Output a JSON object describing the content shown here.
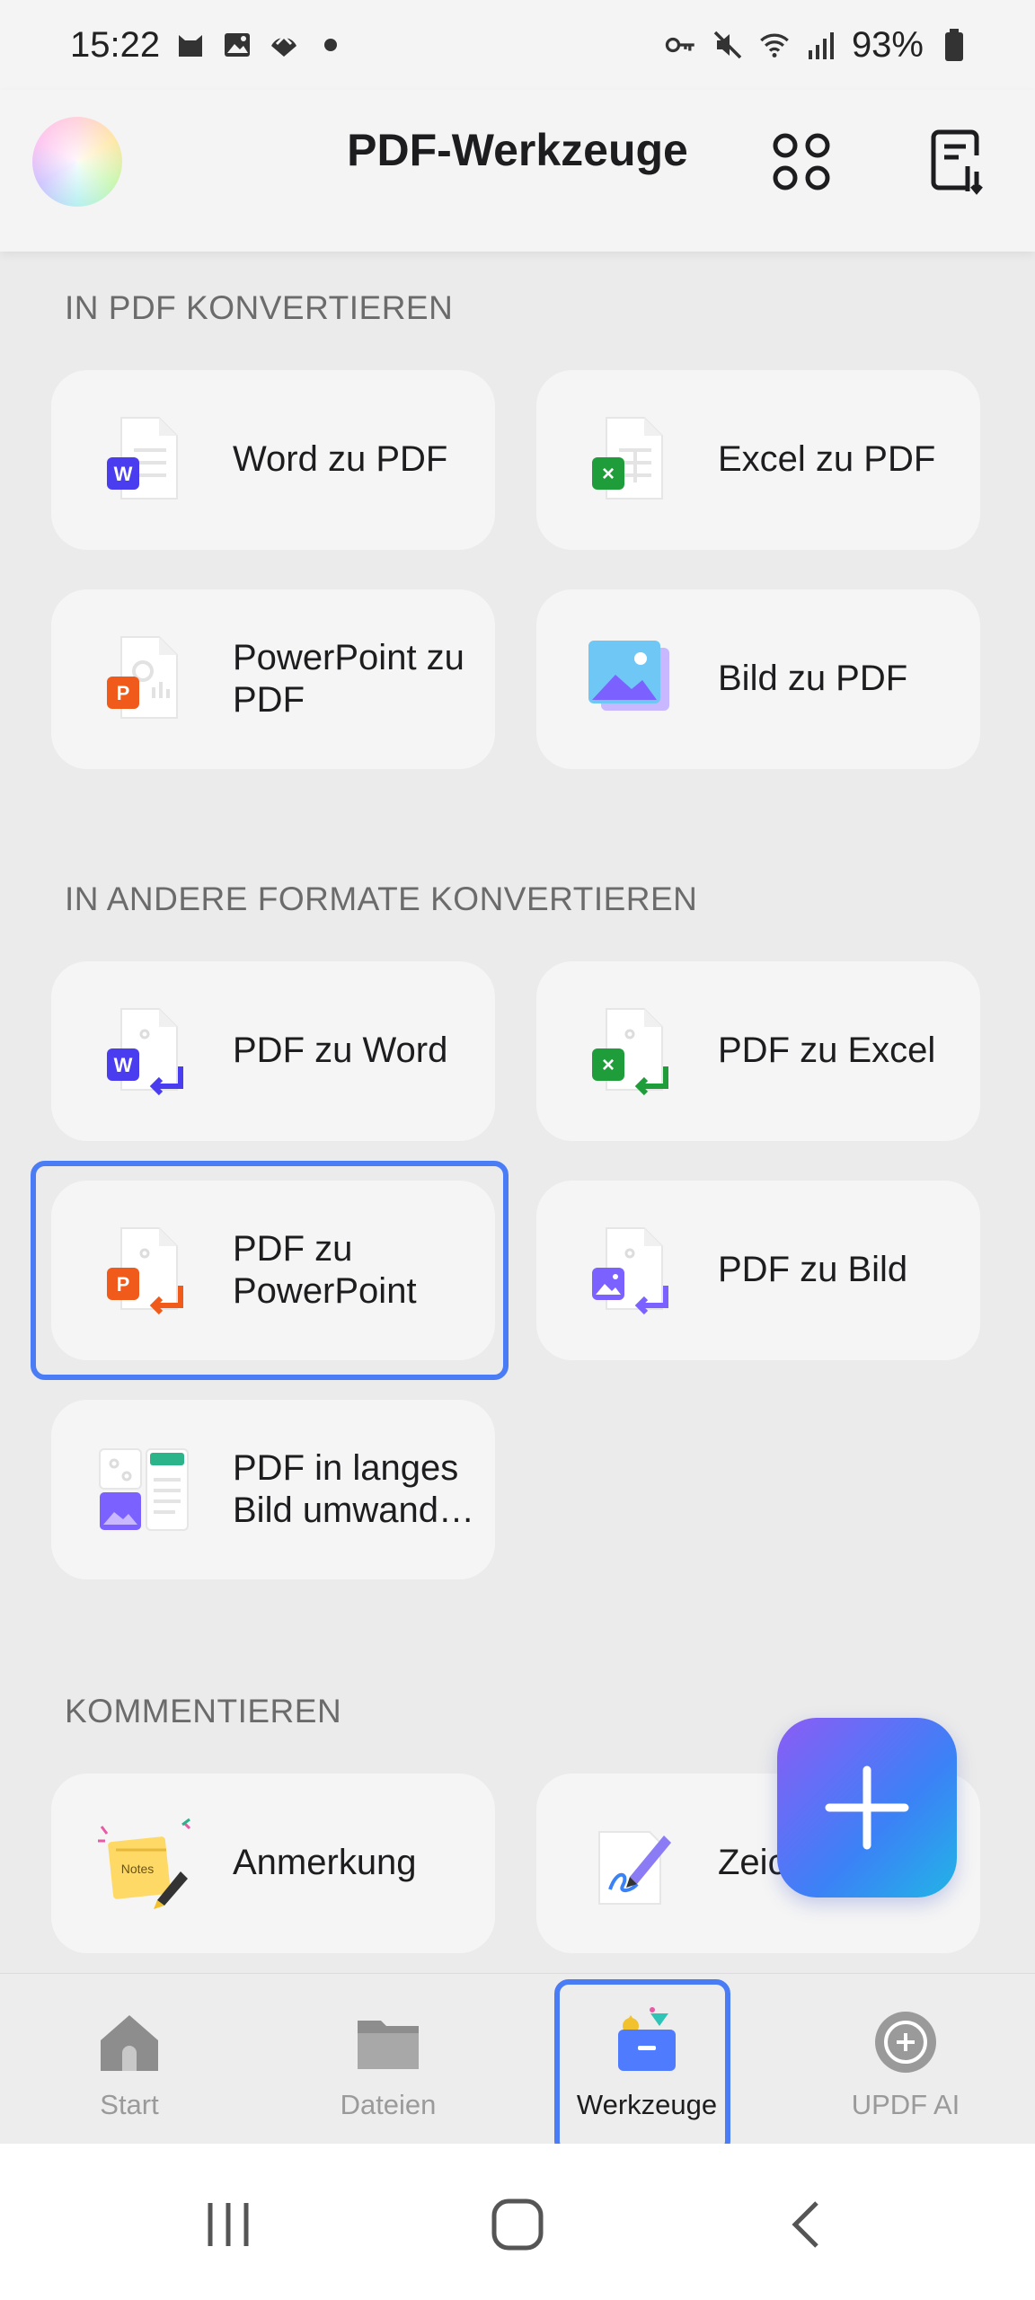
{
  "status_bar": {
    "time": "15:22",
    "battery": "93%",
    "left_icons": [
      "cat-notification-icon",
      "image-notification-icon",
      "cloud-notification-icon",
      "dot-icon"
    ],
    "right_icons": [
      "key-icon",
      "mute-icon",
      "wifi-icon",
      "signal-icon",
      "battery-icon"
    ]
  },
  "header": {
    "title": "PDF-Werkzeuge",
    "grid_icon": "grid-icon",
    "sort_icon": "sort-document-icon"
  },
  "sections": {
    "convert_to_pdf": {
      "title": "IN PDF KONVERTIEREN",
      "items": [
        {
          "label": "Word zu PDF",
          "icon": "word-doc-icon"
        },
        {
          "label": "Excel zu PDF",
          "icon": "excel-doc-icon"
        },
        {
          "label": "PowerPoint zu PDF",
          "icon": "powerpoint-doc-icon"
        },
        {
          "label": "Bild zu PDF",
          "icon": "image-stack-icon"
        }
      ]
    },
    "convert_from_pdf": {
      "title": "IN ANDERE FORMATE KONVERTIEREN",
      "items": [
        {
          "label": "PDF zu Word",
          "icon": "pdf-to-word-icon"
        },
        {
          "label": "PDF zu Excel",
          "icon": "pdf-to-excel-icon"
        },
        {
          "label": "PDF zu PowerPoint",
          "icon": "pdf-to-powerpoint-icon"
        },
        {
          "label": "PDF zu Bild",
          "icon": "pdf-to-image-icon"
        },
        {
          "label": "PDF in langes Bild umwand…",
          "icon": "long-image-icon"
        }
      ]
    },
    "comment": {
      "title": "KOMMENTIEREN",
      "items": [
        {
          "label": "Anmerkung",
          "icon": "sticky-note-icon"
        },
        {
          "label": "Zeic",
          "icon": "pen-sign-icon"
        }
      ]
    }
  },
  "fab": {
    "icon": "plus-icon"
  },
  "bottom_nav": {
    "items": [
      {
        "label": "Start",
        "icon": "home-icon"
      },
      {
        "label": "Dateien",
        "icon": "folder-icon"
      },
      {
        "label": "Werkzeuge",
        "icon": "toolbox-icon",
        "active": true
      },
      {
        "label": "UPDF AI",
        "icon": "ai-icon"
      }
    ]
  },
  "system_nav": {
    "icons": [
      "recents-icon",
      "home-circle-icon",
      "back-icon"
    ]
  },
  "colors": {
    "accent": "#4a7cf5",
    "word": "#4a3df0",
    "excel": "#1f9d3a",
    "powerpoint": "#f05a1a",
    "image": "#7b61ff"
  }
}
